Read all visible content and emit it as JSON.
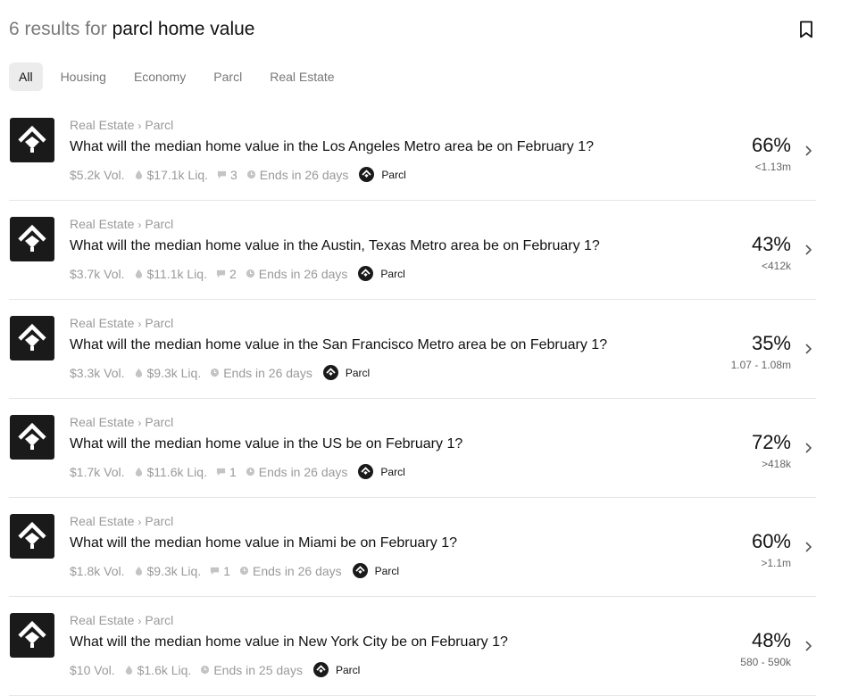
{
  "header": {
    "count_text": "6 results for",
    "query": "parcl home value"
  },
  "tabs": [
    {
      "label": "All",
      "active": true
    },
    {
      "label": "Housing",
      "active": false
    },
    {
      "label": "Economy",
      "active": false
    },
    {
      "label": "Parcl",
      "active": false
    },
    {
      "label": "Real Estate",
      "active": false
    }
  ],
  "results": [
    {
      "crumb1": "Real Estate",
      "crumb2": "Parcl",
      "question": "What will the median home value in the Los Angeles Metro area be on February 1?",
      "vol": "$5.2k Vol.",
      "liq": "$17.1k Liq.",
      "comments": "3",
      "ends": "Ends in 26 days",
      "source": "Parcl",
      "pct": "66%",
      "range": "<1.13m"
    },
    {
      "crumb1": "Real Estate",
      "crumb2": "Parcl",
      "question": "What will the median home value in the Austin, Texas Metro area be on February 1?",
      "vol": "$3.7k Vol.",
      "liq": "$11.1k Liq.",
      "comments": "2",
      "ends": "Ends in 26 days",
      "source": "Parcl",
      "pct": "43%",
      "range": "<412k"
    },
    {
      "crumb1": "Real Estate",
      "crumb2": "Parcl",
      "question": "What will the median home value in the San Francisco Metro area be on February 1?",
      "vol": "$3.3k Vol.",
      "liq": "$9.3k Liq.",
      "comments": "",
      "ends": "Ends in 26 days",
      "source": "Parcl",
      "pct": "35%",
      "range": "1.07 - 1.08m"
    },
    {
      "crumb1": "Real Estate",
      "crumb2": "Parcl",
      "question": "What will the median home value in the US be on February 1?",
      "vol": "$1.7k Vol.",
      "liq": "$11.6k Liq.",
      "comments": "1",
      "ends": "Ends in 26 days",
      "source": "Parcl",
      "pct": "72%",
      "range": ">418k"
    },
    {
      "crumb1": "Real Estate",
      "crumb2": "Parcl",
      "question": "What will the median home value in Miami be on February 1?",
      "vol": "$1.8k Vol.",
      "liq": "$9.3k Liq.",
      "comments": "1",
      "ends": "Ends in 26 days",
      "source": "Parcl",
      "pct": "60%",
      "range": ">1.1m"
    },
    {
      "crumb1": "Real Estate",
      "crumb2": "Parcl",
      "question": "What will the median home value in New York City be on February 1?",
      "vol": "$10 Vol.",
      "liq": "$1.6k Liq.",
      "comments": "",
      "ends": "Ends in 25 days",
      "source": "Parcl",
      "pct": "48%",
      "range": "580 - 590k"
    }
  ]
}
